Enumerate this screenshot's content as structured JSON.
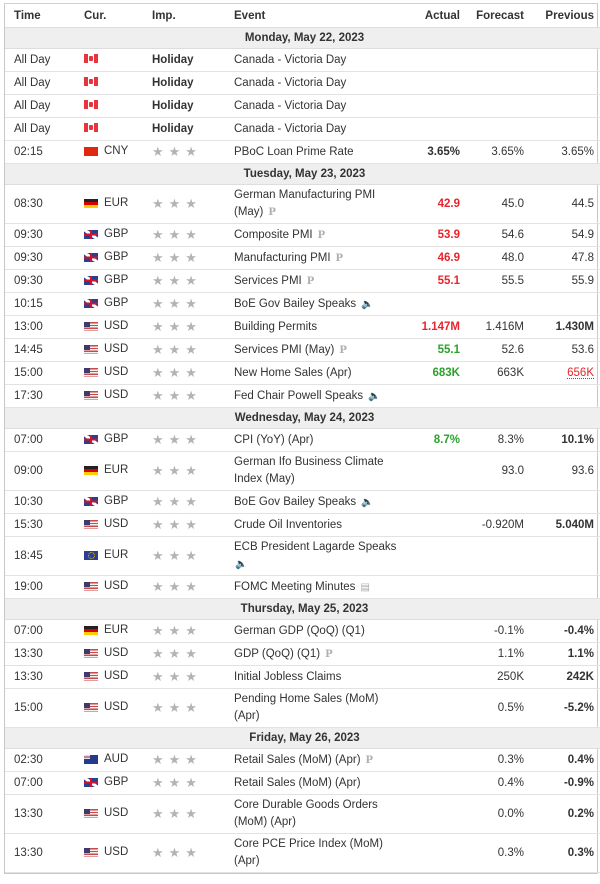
{
  "header": {
    "time": "Time",
    "currency": "Cur.",
    "importance": "Imp.",
    "event": "Event",
    "actual": "Actual",
    "forecast": "Forecast",
    "previous": "Previous"
  },
  "days": [
    {
      "label": "Monday, May 22, 2023",
      "events": [
        {
          "time": "All Day",
          "flag": "ca",
          "currency": "",
          "importance": "Holiday",
          "event": "Canada - Victoria Day",
          "icon": "",
          "actual": "",
          "actual_style": "",
          "forecast": "",
          "previous": "",
          "previous_style": ""
        },
        {
          "time": "All Day",
          "flag": "ca",
          "currency": "",
          "importance": "Holiday",
          "event": "Canada - Victoria Day",
          "icon": "",
          "actual": "",
          "actual_style": "",
          "forecast": "",
          "previous": "",
          "previous_style": ""
        },
        {
          "time": "All Day",
          "flag": "ca",
          "currency": "",
          "importance": "Holiday",
          "event": "Canada - Victoria Day",
          "icon": "",
          "actual": "",
          "actual_style": "",
          "forecast": "",
          "previous": "",
          "previous_style": ""
        },
        {
          "time": "All Day",
          "flag": "ca",
          "currency": "",
          "importance": "Holiday",
          "event": "Canada - Victoria Day",
          "icon": "",
          "actual": "",
          "actual_style": "",
          "forecast": "",
          "previous": "",
          "previous_style": ""
        },
        {
          "time": "02:15",
          "flag": "cn",
          "currency": "CNY",
          "importance": "3",
          "event": "PBoC Loan Prime Rate",
          "icon": "",
          "actual": "3.65%",
          "actual_style": "bold",
          "forecast": "3.65%",
          "previous": "3.65%",
          "previous_style": ""
        }
      ]
    },
    {
      "label": "Tuesday, May 23, 2023",
      "events": [
        {
          "time": "08:30",
          "flag": "de",
          "currency": "EUR",
          "importance": "3",
          "event": "German Manufacturing PMI (May)",
          "icon": "preliminary",
          "two_line": true,
          "actual": "42.9",
          "actual_style": "red",
          "forecast": "45.0",
          "previous": "44.5",
          "previous_style": ""
        },
        {
          "time": "09:30",
          "flag": "gb",
          "currency": "GBP",
          "importance": "3",
          "event": "Composite PMI",
          "icon": "preliminary",
          "actual": "53.9",
          "actual_style": "red",
          "forecast": "54.6",
          "previous": "54.9",
          "previous_style": ""
        },
        {
          "time": "09:30",
          "flag": "gb",
          "currency": "GBP",
          "importance": "3",
          "event": "Manufacturing PMI",
          "icon": "preliminary",
          "actual": "46.9",
          "actual_style": "red",
          "forecast": "48.0",
          "previous": "47.8",
          "previous_style": ""
        },
        {
          "time": "09:30",
          "flag": "gb",
          "currency": "GBP",
          "importance": "3",
          "event": "Services PMI",
          "icon": "preliminary",
          "actual": "55.1",
          "actual_style": "red",
          "forecast": "55.5",
          "previous": "55.9",
          "previous_style": ""
        },
        {
          "time": "10:15",
          "flag": "gb",
          "currency": "GBP",
          "importance": "3",
          "event": "BoE Gov Bailey Speaks",
          "icon": "speech",
          "actual": "",
          "actual_style": "",
          "forecast": "",
          "previous": "",
          "previous_style": ""
        },
        {
          "time": "13:00",
          "flag": "us",
          "currency": "USD",
          "importance": "3",
          "event": "Building Permits",
          "icon": "",
          "actual": "1.147M",
          "actual_style": "red",
          "forecast": "1.416M",
          "previous": "1.430M",
          "previous_style": "bold"
        },
        {
          "time": "14:45",
          "flag": "us",
          "currency": "USD",
          "importance": "3",
          "event": "Services PMI (May)",
          "icon": "preliminary",
          "actual": "55.1",
          "actual_style": "green",
          "forecast": "52.6",
          "previous": "53.6",
          "previous_style": ""
        },
        {
          "time": "15:00",
          "flag": "us",
          "currency": "USD",
          "importance": "3",
          "event": "New Home Sales (Apr)",
          "icon": "",
          "actual": "683K",
          "actual_style": "green",
          "forecast": "663K",
          "previous": "656K",
          "previous_style": "revised"
        },
        {
          "time": "17:30",
          "flag": "us",
          "currency": "USD",
          "importance": "3",
          "event": "Fed Chair Powell Speaks",
          "icon": "speech",
          "actual": "",
          "actual_style": "",
          "forecast": "",
          "previous": "",
          "previous_style": ""
        }
      ]
    },
    {
      "label": "Wednesday, May 24, 2023",
      "events": [
        {
          "time": "07:00",
          "flag": "gb",
          "currency": "GBP",
          "importance": "3",
          "event": "CPI (YoY) (Apr)",
          "icon": "",
          "actual": "8.7%",
          "actual_style": "green",
          "forecast": "8.3%",
          "previous": "10.1%",
          "previous_style": "bold"
        },
        {
          "time": "09:00",
          "flag": "de",
          "currency": "EUR",
          "importance": "3",
          "event": "German Ifo Business Climate Index (May)",
          "icon": "",
          "two_line": true,
          "actual": "",
          "actual_style": "",
          "forecast": "93.0",
          "previous": "93.6",
          "previous_style": ""
        },
        {
          "time": "10:30",
          "flag": "gb",
          "currency": "GBP",
          "importance": "3",
          "event": "BoE Gov Bailey Speaks",
          "icon": "speech",
          "actual": "",
          "actual_style": "",
          "forecast": "",
          "previous": "",
          "previous_style": ""
        },
        {
          "time": "15:30",
          "flag": "us",
          "currency": "USD",
          "importance": "3",
          "event": "Crude Oil Inventories",
          "icon": "",
          "actual": "",
          "actual_style": "",
          "forecast": "-0.920M",
          "previous": "5.040M",
          "previous_style": "bold"
        },
        {
          "time": "18:45",
          "flag": "eu",
          "currency": "EUR",
          "importance": "3",
          "event": "ECB President Lagarde Speaks",
          "icon": "speech",
          "two_line": true,
          "actual": "",
          "actual_style": "",
          "forecast": "",
          "previous": "",
          "previous_style": ""
        },
        {
          "time": "19:00",
          "flag": "us",
          "currency": "USD",
          "importance": "3",
          "event": "FOMC Meeting Minutes",
          "icon": "report",
          "actual": "",
          "actual_style": "",
          "forecast": "",
          "previous": "",
          "previous_style": ""
        }
      ]
    },
    {
      "label": "Thursday, May 25, 2023",
      "events": [
        {
          "time": "07:00",
          "flag": "de",
          "currency": "EUR",
          "importance": "3",
          "event": "German GDP (QoQ) (Q1)",
          "icon": "",
          "actual": "",
          "actual_style": "",
          "forecast": "-0.1%",
          "previous": "-0.4%",
          "previous_style": "bold"
        },
        {
          "time": "13:30",
          "flag": "us",
          "currency": "USD",
          "importance": "3",
          "event": "GDP (QoQ) (Q1)",
          "icon": "preliminary",
          "actual": "",
          "actual_style": "",
          "forecast": "1.1%",
          "previous": "1.1%",
          "previous_style": "bold"
        },
        {
          "time": "13:30",
          "flag": "us",
          "currency": "USD",
          "importance": "3",
          "event": "Initial Jobless Claims",
          "icon": "",
          "actual": "",
          "actual_style": "",
          "forecast": "250K",
          "previous": "242K",
          "previous_style": "bold"
        },
        {
          "time": "15:00",
          "flag": "us",
          "currency": "USD",
          "importance": "3",
          "event": "Pending Home Sales (MoM) (Apr)",
          "icon": "",
          "two_line": true,
          "actual": "",
          "actual_style": "",
          "forecast": "0.5%",
          "previous": "-5.2%",
          "previous_style": "bold"
        }
      ]
    },
    {
      "label": "Friday, May 26, 2023",
      "events": [
        {
          "time": "02:30",
          "flag": "au",
          "currency": "AUD",
          "importance": "3",
          "event": "Retail Sales (MoM) (Apr)",
          "icon": "preliminary",
          "actual": "",
          "actual_style": "",
          "forecast": "0.3%",
          "previous": "0.4%",
          "previous_style": "bold"
        },
        {
          "time": "07:00",
          "flag": "gb",
          "currency": "GBP",
          "importance": "3",
          "event": "Retail Sales (MoM) (Apr)",
          "icon": "",
          "actual": "",
          "actual_style": "",
          "forecast": "0.4%",
          "previous": "-0.9%",
          "previous_style": "bold"
        },
        {
          "time": "13:30",
          "flag": "us",
          "currency": "USD",
          "importance": "3",
          "event": "Core Durable Goods Orders (MoM) (Apr)",
          "icon": "",
          "two_line": true,
          "actual": "",
          "actual_style": "",
          "forecast": "0.0%",
          "previous": "0.2%",
          "previous_style": "bold"
        },
        {
          "time": "13:30",
          "flag": "us",
          "currency": "USD",
          "importance": "3",
          "event": "Core PCE Price Index (MoM) (Apr)",
          "icon": "",
          "two_line": true,
          "actual": "",
          "actual_style": "",
          "forecast": "0.3%",
          "previous": "0.3%",
          "previous_style": "bold"
        }
      ]
    }
  ],
  "icons": {
    "preliminary": "P",
    "speech": "🔈",
    "report": "▤"
  },
  "colors": {
    "negative": "#e8242c",
    "positive": "#2ca02c",
    "star": "#b3b3b3",
    "day_header_bg": "#efefef"
  }
}
